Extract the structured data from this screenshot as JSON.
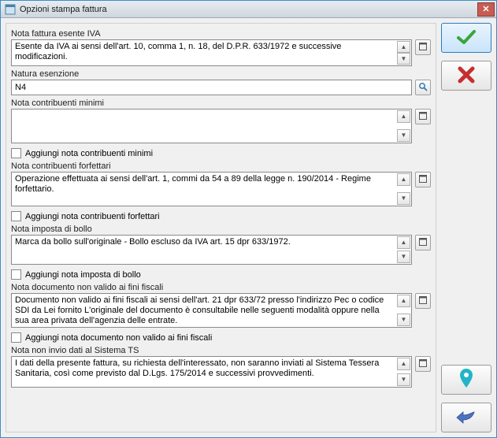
{
  "window": {
    "title": "Opzioni stampa fattura"
  },
  "labels": {
    "nota_esente": "Nota fattura esente IVA",
    "natura_esenzione": "Natura esenzione",
    "nota_minimi": "Nota contribuenti minimi",
    "agg_minimi": "Aggiungi nota contribuenti minimi",
    "nota_forfettari": "Nota contribuenti forfettari",
    "agg_forfettari": "Aggiungi nota contribuenti forfettari",
    "nota_bollo": "Nota imposta di bollo",
    "agg_bollo": "Aggiungi nota imposta di bollo",
    "nota_doc_nonvalido": "Nota documento non valido ai fini fiscali",
    "agg_doc_nonvalido": "Aggiungi nota documento non valido ai fini fiscali",
    "nota_ts": "Nota non invio dati al Sistema TS"
  },
  "values": {
    "nota_esente": "Esente da IVA ai sensi dell'art. 10, comma 1, n. 18, del D.P.R. 633/1972 e successive modificazioni.",
    "natura_esenzione": "N4",
    "nota_minimi": "",
    "nota_forfettari": "Operazione effettuata ai sensi dell'art. 1, commi da 54 a 89 della legge n. 190/2014 - Regime forfettario.",
    "nota_bollo": "Marca da bollo sull'originale - Bollo escluso da IVA art. 15 dpr 633/1972.",
    "nota_doc_nonvalido": "Documento non valido ai fini fiscali ai sensi dell'art. 21 dpr 633/72 presso l'indirizzo Pec o codice SDI da Lei fornito L'originale del documento è consultabile nelle seguenti modalità oppure nella sua area privata dell'agenzia delle entrate.",
    "nota_ts": "I dati della presente fattura, su richiesta dell'interessato, non saranno inviati al Sistema Tessera Sanitaria, così come previsto dal D.Lgs. 175/2014 e successivi provvedimenti."
  }
}
